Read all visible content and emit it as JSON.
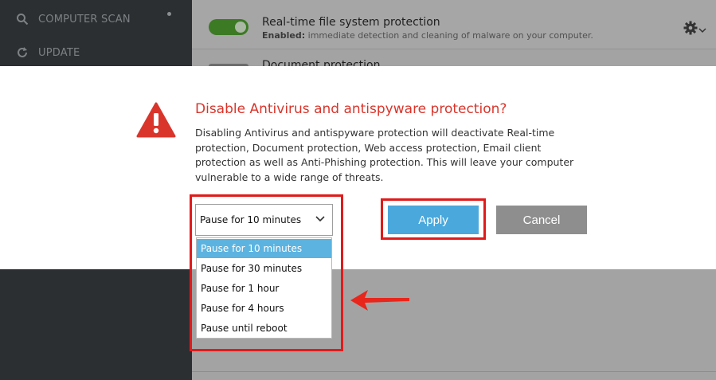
{
  "sidebar": {
    "items": [
      {
        "label": "COMPUTER SCAN",
        "icon": "search-icon"
      },
      {
        "label": "UPDATE",
        "icon": "refresh-icon"
      }
    ]
  },
  "background": {
    "row1": {
      "title": "Real-time file system protection",
      "desc_prefix": "Enabled:",
      "desc_text": " immediate detection and cleaning of malware on your computer."
    },
    "row2": {
      "title": "Document protection"
    }
  },
  "dialog": {
    "title": "Disable Antivirus and antispyware protection?",
    "text": "Disabling Antivirus and antispyware protection will deactivate Real-time protection, Document protection, Web access protection, Email client protection as well as Anti-Phishing protection. This will leave your computer vulnerable to a wide range of threats.",
    "select_value": "Pause for 10 minutes",
    "options": [
      "Pause for 10 minutes",
      "Pause for 30 minutes",
      "Pause for 1 hour",
      "Pause for 4 hours",
      "Pause until reboot"
    ],
    "selected_index": 0,
    "apply_label": "Apply",
    "cancel_label": "Cancel"
  },
  "colors": {
    "warning_red": "#d9352b",
    "apply_blue": "#4aa8dc",
    "highlight_red": "#e01b1b",
    "selected_blue": "#5cb3e0"
  }
}
